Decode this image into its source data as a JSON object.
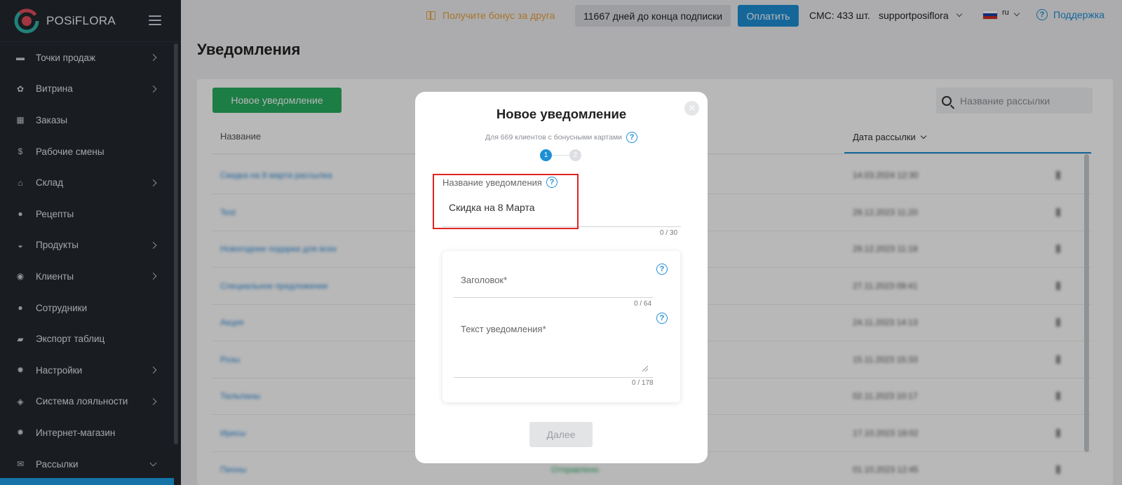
{
  "app": {
    "name": "POSiFLORA"
  },
  "sidebar": {
    "items": [
      {
        "label": "Точки продаж",
        "icon": "store-icon",
        "glyph": "▬",
        "has_children": true
      },
      {
        "label": "Витрина",
        "icon": "flower-icon",
        "glyph": "✿",
        "has_children": true
      },
      {
        "label": "Заказы",
        "icon": "calendar-icon",
        "glyph": "▦",
        "has_children": false
      },
      {
        "label": "Рабочие смены",
        "icon": "dollar-icon",
        "glyph": "$",
        "has_children": false
      },
      {
        "label": "Склад",
        "icon": "warehouse-icon",
        "glyph": "⌂",
        "has_children": true
      },
      {
        "label": "Рецепты",
        "icon": "recipe-icon",
        "glyph": "●",
        "has_children": false
      },
      {
        "label": "Продукты",
        "icon": "basket-icon",
        "glyph": "◒",
        "has_children": true
      },
      {
        "label": "Клиенты",
        "icon": "client-icon",
        "glyph": "◉",
        "has_children": true
      },
      {
        "label": "Сотрудники",
        "icon": "employee-icon",
        "glyph": "●",
        "has_children": false
      },
      {
        "label": "Экспорт таблиц",
        "icon": "folder-icon",
        "glyph": "▰",
        "has_children": false
      },
      {
        "label": "Настройки",
        "icon": "gear-icon",
        "glyph": "✹",
        "has_children": true
      },
      {
        "label": "Система лояльности",
        "icon": "tag-icon",
        "glyph": "◈",
        "has_children": true
      },
      {
        "label": "Интернет-магазин",
        "icon": "shop-gear-icon",
        "glyph": "✹",
        "has_children": false
      },
      {
        "label": "Рассылки",
        "icon": "mail-icon",
        "glyph": "✉",
        "has_children": true,
        "expanded": true
      }
    ]
  },
  "topbar": {
    "bonus": "Получите бонус за друга",
    "subscription": "11667 дней до конца подписки",
    "pay_label": "Оплатить",
    "sms": "СМС: 433 шт.",
    "user": "supportposiflora",
    "lang": "ru",
    "help": "Поддержка"
  },
  "page": {
    "title": "Уведомления",
    "new_button": "Новое уведомление",
    "search_placeholder": "Название рассылки",
    "columns": {
      "name": "Название",
      "date": "Дата рассылки"
    },
    "rows": [
      {
        "name": "Скидка на 8 марта рассылка",
        "date": "14.03.2024 12:30"
      },
      {
        "name": "Test",
        "date": "29.12.2023 11:20"
      },
      {
        "name": "Новогодние подарки для всех",
        "date": "29.12.2023 11:18"
      },
      {
        "name": "Специальное предложение",
        "date": "27.11.2023 09:41"
      },
      {
        "name": "Акция",
        "date": "24.11.2023 14:13"
      },
      {
        "name": "Розы",
        "date": "15.11.2023 15:33"
      },
      {
        "name": "Тюльпаны",
        "date": "02.11.2023 10:17"
      },
      {
        "name": "Ирисы",
        "date": "17.10.2023 18:02"
      },
      {
        "name": "Пионы",
        "date": "01.10.2023 12:45",
        "status": "Отправлено"
      }
    ]
  },
  "modal": {
    "title": "Новое уведомление",
    "subtitle": "Для 669 клиентов с бонусными картами",
    "steps": [
      "1",
      "2"
    ],
    "name_label": "Название уведомления",
    "name_value": "Скидка на 8 Марта",
    "name_counter": "0 / 30",
    "header_label": "Заголовок*",
    "header_counter": "0 / 64",
    "text_label": "Текст уведомления*",
    "text_counter": "0 / 178",
    "next_label": "Далее",
    "close_glyph": "×",
    "help_glyph": "?"
  },
  "colors": {
    "sidebar_bg": "#23282f",
    "accent_blue": "#1e8fd6",
    "accent_green": "#27ae60",
    "bonus_orange": "#e8a23c",
    "highlight_red": "#e02424"
  }
}
